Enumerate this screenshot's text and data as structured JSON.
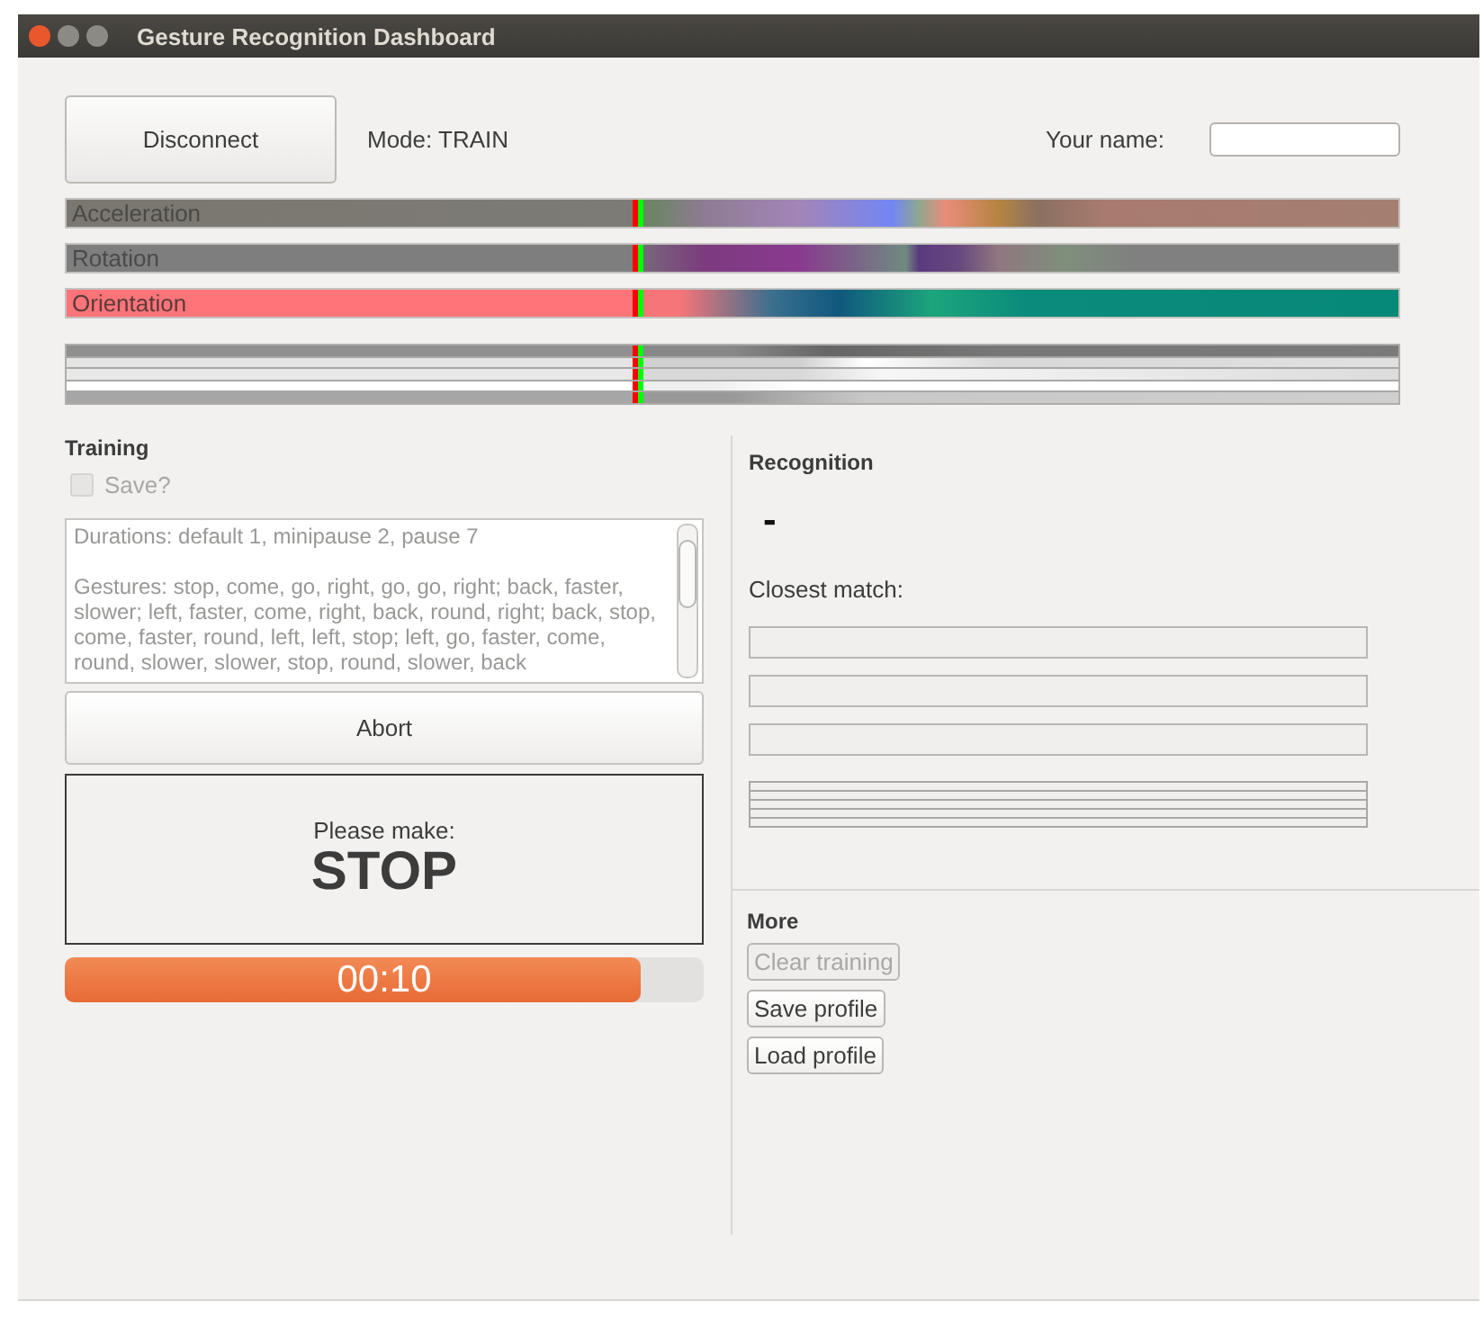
{
  "window": {
    "title": "Gesture Recognition Dashboard"
  },
  "toolbar": {
    "connect_button": "Disconnect",
    "mode": "Mode: TRAIN",
    "name_label": "Your name:"
  },
  "sensor_strips": [
    {
      "label": "Acceleration"
    },
    {
      "label": "Rotation"
    },
    {
      "label": "Orientation"
    }
  ],
  "training": {
    "title": "Training",
    "save_checkbox": {
      "label": "Save?",
      "checked": false,
      "disabled": true
    },
    "script_text": [
      "Durations: default 1, minipause 2, pause 7",
      "Gestures: stop, come, go, right, go, go, right; back, faster, slower; left, faster, come, right, back, round, right; back, stop, come, faster, round, left, left, stop; left, go, faster, come, round, slower, slower, stop, round, slower, back"
    ],
    "abort_button": "Abort",
    "prompt": "Please make:",
    "gesture": "STOP",
    "timer": {
      "level": 0.9,
      "reading": "00:10"
    }
  },
  "recognition": {
    "title": "Recognition",
    "result": "-",
    "closest_label": "Closest match:"
  },
  "more": {
    "title": "More",
    "buttons": [
      {
        "label": "Clear training",
        "disabled": true
      },
      {
        "label": "Save profile",
        "disabled": false
      },
      {
        "label": "Load profile",
        "disabled": false
      }
    ]
  }
}
